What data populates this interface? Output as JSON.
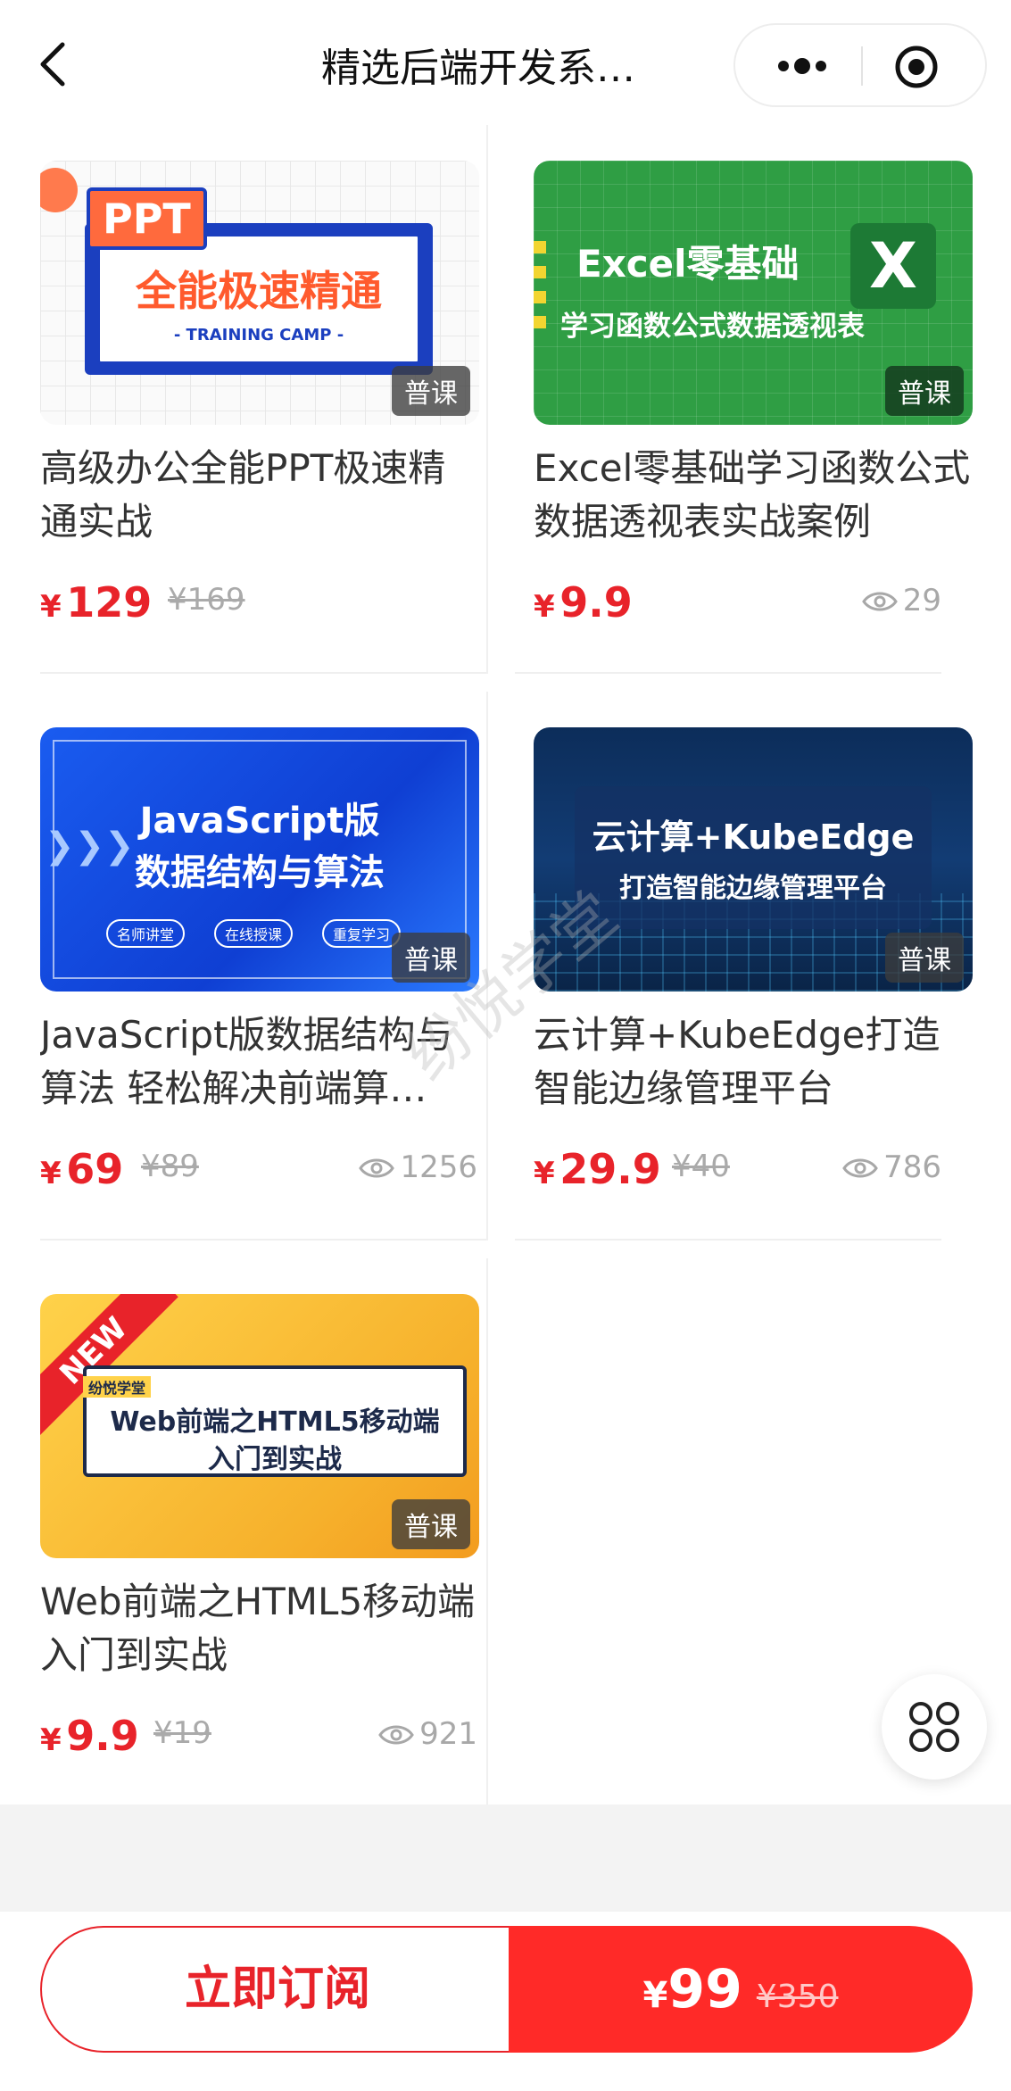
{
  "nav": {
    "title": "精选后端开发系…"
  },
  "courses": [
    {
      "title": "高级办公全能PPT极速精通实战",
      "price_symbol": "¥",
      "price": "129",
      "original": "¥169",
      "views": "",
      "badge": "普课",
      "thumb": {
        "line1": "PPT",
        "line2": "全能极速精通",
        "line3": "- TRAINING CAMP -"
      }
    },
    {
      "title": "Excel零基础学习函数公式数据透视表实战案例",
      "price_symbol": "¥",
      "price": "9.9",
      "original": "",
      "views": "29",
      "badge": "普课",
      "thumb": {
        "line1": "Excel零基础",
        "line2": "学习函数公式数据透视表",
        "logo": "X"
      }
    },
    {
      "title": "JavaScript版数据结构与算法 轻松解决前端算…",
      "price_symbol": "¥",
      "price": "69",
      "original": "¥89",
      "views": "1256",
      "badge": "普课",
      "thumb": {
        "line1": "JavaScript版",
        "line2": "数据结构与算法",
        "tags": [
          "名师讲堂",
          "在线授课",
          "重复学习"
        ]
      }
    },
    {
      "title": "云计算+KubeEdge打造智能边缘管理平台",
      "price_symbol": "¥",
      "price": "29.9",
      "original": "¥40",
      "views": "786",
      "badge": "普课",
      "thumb": {
        "line1": "云计算+KubeEdge",
        "line2": "打造智能边缘管理平台"
      }
    },
    {
      "title": "Web前端之HTML5移动端入门到实战",
      "price_symbol": "¥",
      "price": "9.9",
      "original": "¥19",
      "views": "921",
      "badge": "普课",
      "thumb": {
        "ribbon": "NEW",
        "brand": "纷悦学堂",
        "line1": "Web前端之HTML5移动端",
        "line2": "入门到实战"
      }
    }
  ],
  "watermark": "纷悦学堂",
  "footer": {
    "subscribe_label": "立即订阅",
    "price_symbol": "¥",
    "price": "99",
    "original": "¥350"
  },
  "colors": {
    "accent": "#e8232a",
    "buy_bg": "#ff2a28"
  }
}
